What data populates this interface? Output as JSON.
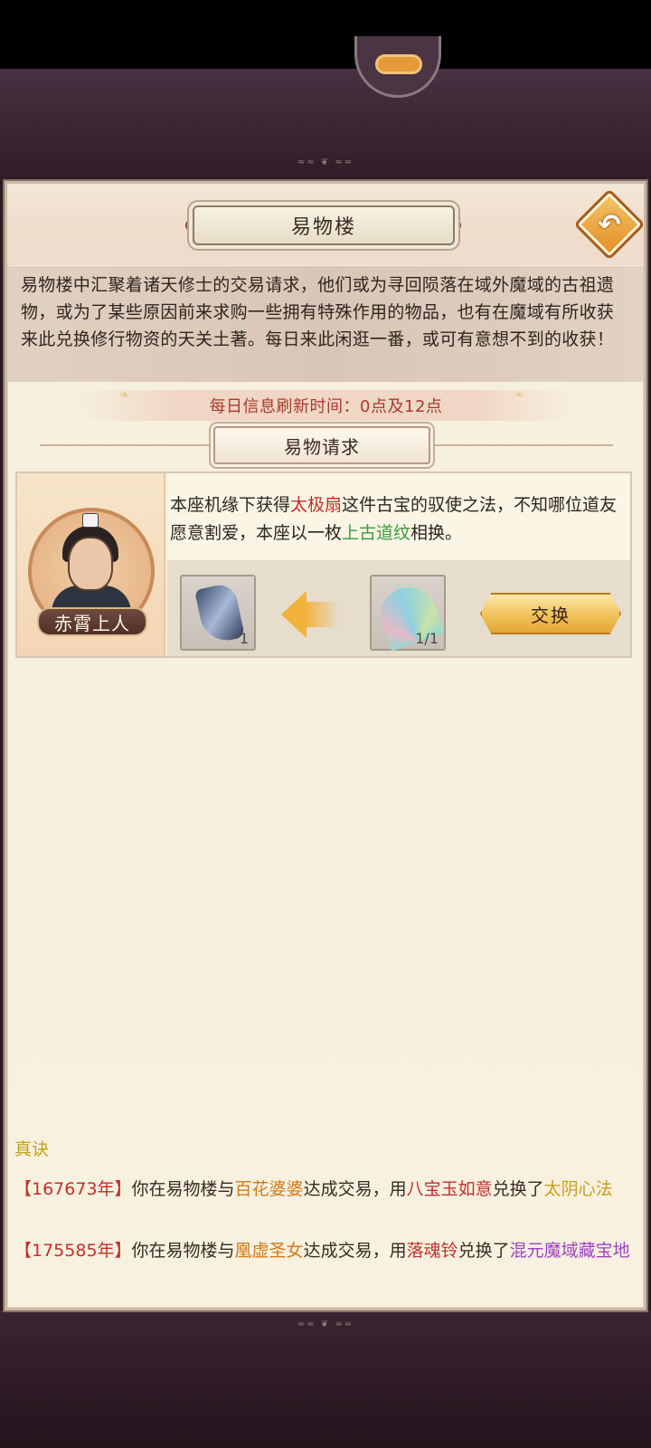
{
  "header": {
    "title": "易物楼"
  },
  "intro": {
    "text": "易物楼中汇聚着诸天修士的交易请求，他们或为寻回陨落在域外魔域的古祖遗物，或为了某些原因前来求购一些拥有特殊作用的物品，也有在魔域有所收获来此兑换修行物资的天关土著。每日来此闲逛一番，或可有意想不到的收获！"
  },
  "refresh": {
    "text": "每日信息刷新时间：0点及12点"
  },
  "section": {
    "title": "易物请求"
  },
  "request": {
    "npc_name": "赤霄上人",
    "dialog": {
      "part1": "本座机缘下获得",
      "item_wanted": "太极扇",
      "part2": "这件古宝的驭使之法，不知哪位道友愿意割爱，本座以一枚",
      "item_offered": "上古道纹",
      "part3": "相换。"
    },
    "reward_count": "1",
    "required_count": "1/1",
    "exchange_label": "交换"
  },
  "log": {
    "cut_line_tail": "真诀",
    "entries": [
      {
        "year": "【167673年】",
        "t1": "你在易物楼与",
        "npc": "百花婆婆",
        "t2": "达成交易，用",
        "item_given": "八宝玉如意",
        "t3": "兑换了",
        "item_received": "太阴心法"
      },
      {
        "year": "【175585年】",
        "t1": "你在易物楼与",
        "npc": "凰虚圣女",
        "t2": "达成交易，用",
        "item_given": "落魂铃",
        "t3": "兑换了",
        "item_received": "混元魔域藏宝地"
      }
    ]
  },
  "colors": {
    "accent_red": "#c0302a",
    "accent_green": "#3a9a3a",
    "accent_orange": "#d27a16",
    "accent_gold": "#c9a020",
    "accent_purple": "#a040c0"
  }
}
